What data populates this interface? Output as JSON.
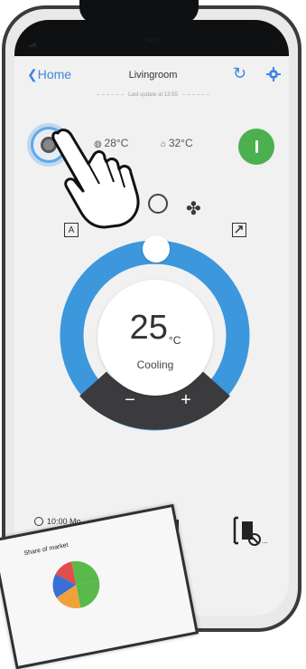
{
  "statusbar": {
    "time": "13:55"
  },
  "nav": {
    "back_label": "Home",
    "title": "Livingroom"
  },
  "last_update": "Last update at 13:55",
  "readings": {
    "indoor": "28°C",
    "outdoor": "32°C"
  },
  "thermostat": {
    "setpoint": "25",
    "unit": "°C",
    "mode": "Cooling",
    "minus": "−",
    "plus": "+"
  },
  "mode_icons": {
    "auto_letter": "A"
  },
  "timer": {
    "time": "10:00 Mo",
    "label": ""
  },
  "photo": {
    "caption": "Share of market"
  },
  "colors": {
    "accent": "#3d86e0",
    "ring": "#3c97dc",
    "power": "#4caf50",
    "dark": "#3b3b3d"
  },
  "icons": [
    "back-chevron-icon",
    "refresh-icon",
    "gear-icon",
    "mode-icon",
    "thermometer-icon",
    "power-icon",
    "sun-icon",
    "fan-icon",
    "auto-icon",
    "expand-icon",
    "clock-icon",
    "fan-speed-icon",
    "swing-icon",
    "hand-pointer-icon"
  ]
}
